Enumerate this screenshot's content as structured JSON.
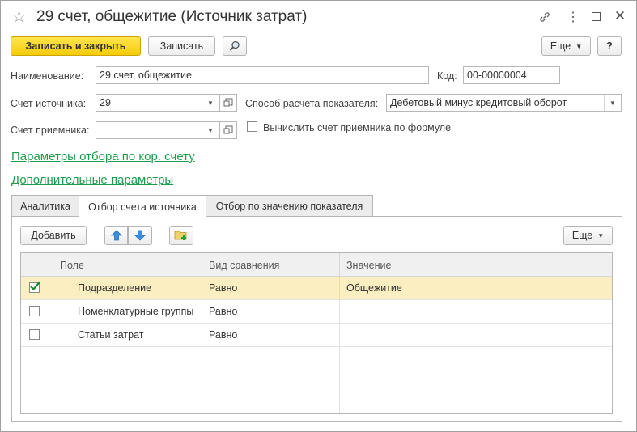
{
  "window": {
    "title": "29 счет, общежитие (Источник затрат)",
    "controls": [
      "link-icon",
      "more-icon",
      "maximize-icon",
      "close-icon"
    ]
  },
  "toolbar": {
    "save_close_label": "Записать и закрыть",
    "save_label": "Записать",
    "more_label": "Еще",
    "help_label": "?"
  },
  "form": {
    "name_label": "Наименование:",
    "name_value": "29 счет, общежитие",
    "code_label": "Код:",
    "code_value": "00-00000004",
    "source_account_label": "Счет источника:",
    "source_account_value": "29",
    "receiver_account_label": "Счет приемника:",
    "receiver_account_value": "",
    "calc_method_label": "Способ расчета показателя:",
    "calc_method_value": "Дебетовый минус кредитовый оборот",
    "formula_checkbox_label": "Вычислить счет приемника по формуле",
    "formula_checked": false
  },
  "links": {
    "filter_params": "Параметры отбора по кор. счету",
    "extra_params": "Дополнительные параметры"
  },
  "tabs": [
    {
      "label": "Аналитика",
      "active": false
    },
    {
      "label": "Отбор счета источника",
      "active": true
    },
    {
      "label": "Отбор по значению показателя",
      "active": false
    }
  ],
  "panel": {
    "add_label": "Добавить",
    "more_label": "Еще"
  },
  "table": {
    "columns": [
      "Поле",
      "Вид сравнения",
      "Значение"
    ],
    "rows": [
      {
        "checked": true,
        "field": "Подразделение",
        "comparison": "Равно",
        "value": "Общежитие",
        "selected": true
      },
      {
        "checked": false,
        "field": "Номенклатурные группы",
        "comparison": "Равно",
        "value": "",
        "selected": false
      },
      {
        "checked": false,
        "field": "Статьи затрат",
        "comparison": "Равно",
        "value": "",
        "selected": false
      }
    ]
  },
  "colors": {
    "primary_button": "#f5cb0a",
    "link": "#1e9c4c",
    "selected_row": "#fbeec0",
    "check": "#1a8a2e"
  }
}
